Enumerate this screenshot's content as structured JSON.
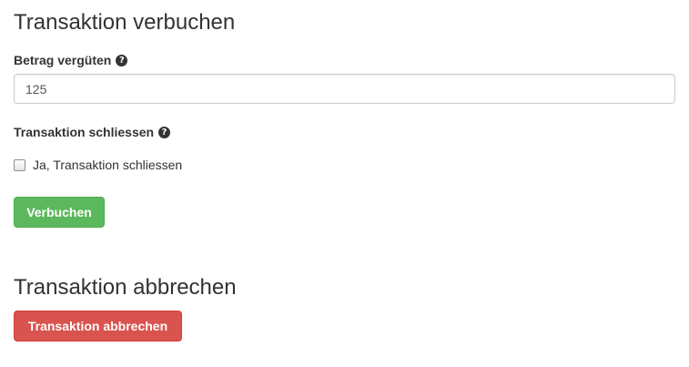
{
  "book_section": {
    "title": "Transaktion verbuchen",
    "amount_label": "Betrag vergüten",
    "amount_value": "125",
    "close_label": "Transaktion schliessen",
    "close_checkbox_label": "Ja, Transaktion schliessen",
    "close_checked": false,
    "submit_label": "Verbuchen",
    "help_icon_glyph": "?"
  },
  "cancel_section": {
    "title": "Transaktion abbrechen",
    "cancel_label": "Transaktion abbrechen"
  },
  "colors": {
    "success": "#5cb85c",
    "danger": "#d9534f",
    "text": "#333333"
  },
  "icons": {
    "help": "question-circle-icon"
  }
}
